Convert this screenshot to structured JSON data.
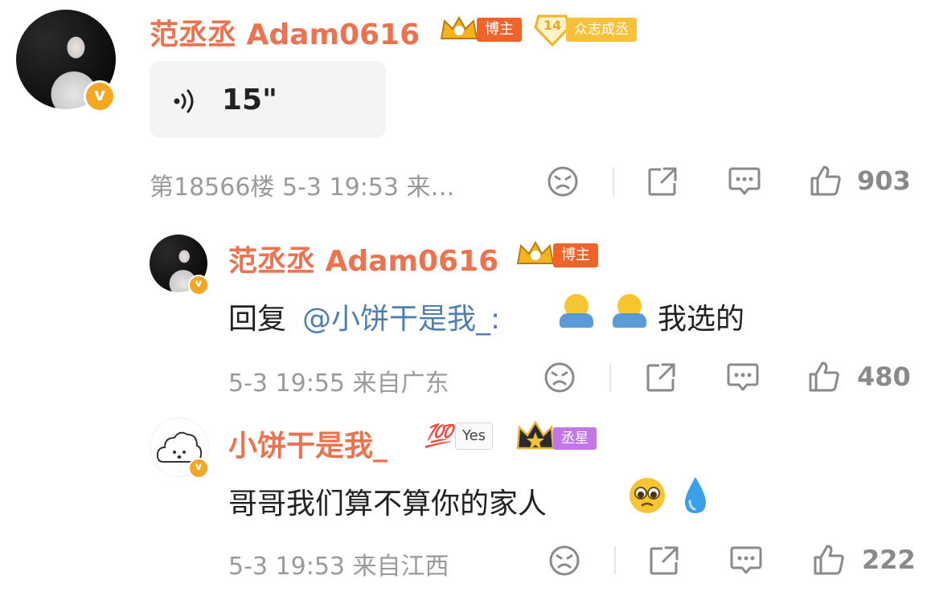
{
  "main_comment": {
    "username": "范丞丞 Adam0616",
    "tags": {
      "bozhu": "博主",
      "level": "14",
      "fan_badge": "众志成丞"
    },
    "voice": {
      "duration": "15\""
    },
    "meta": "第18566楼 5-3 19:53 来…",
    "likes": "903"
  },
  "reply_1": {
    "username": "范丞丞 Adam0616",
    "tag": "博主",
    "text_prefix": "回复",
    "mention": "@小饼干是我_:",
    "text_suffix": "我选的",
    "meta": "5-3 19:55 来自广东",
    "likes": "480"
  },
  "reply_2": {
    "username": "小饼干是我_",
    "tags": {
      "score": "💯",
      "yes": "Yes",
      "star": "丞星"
    },
    "text": "哥哥我们算不算你的家人",
    "meta": "5-3 19:53 来自江西",
    "likes": "222"
  },
  "colors": {
    "username": "#eb7350",
    "mention": "#4d7fb3",
    "meta": "#9a9a9a",
    "vip": "#f5a623"
  },
  "icons": [
    "dislike-icon",
    "share-icon",
    "comment-icon",
    "like-icon",
    "voice-icon",
    "crown-icon",
    "verified-v-icon"
  ]
}
